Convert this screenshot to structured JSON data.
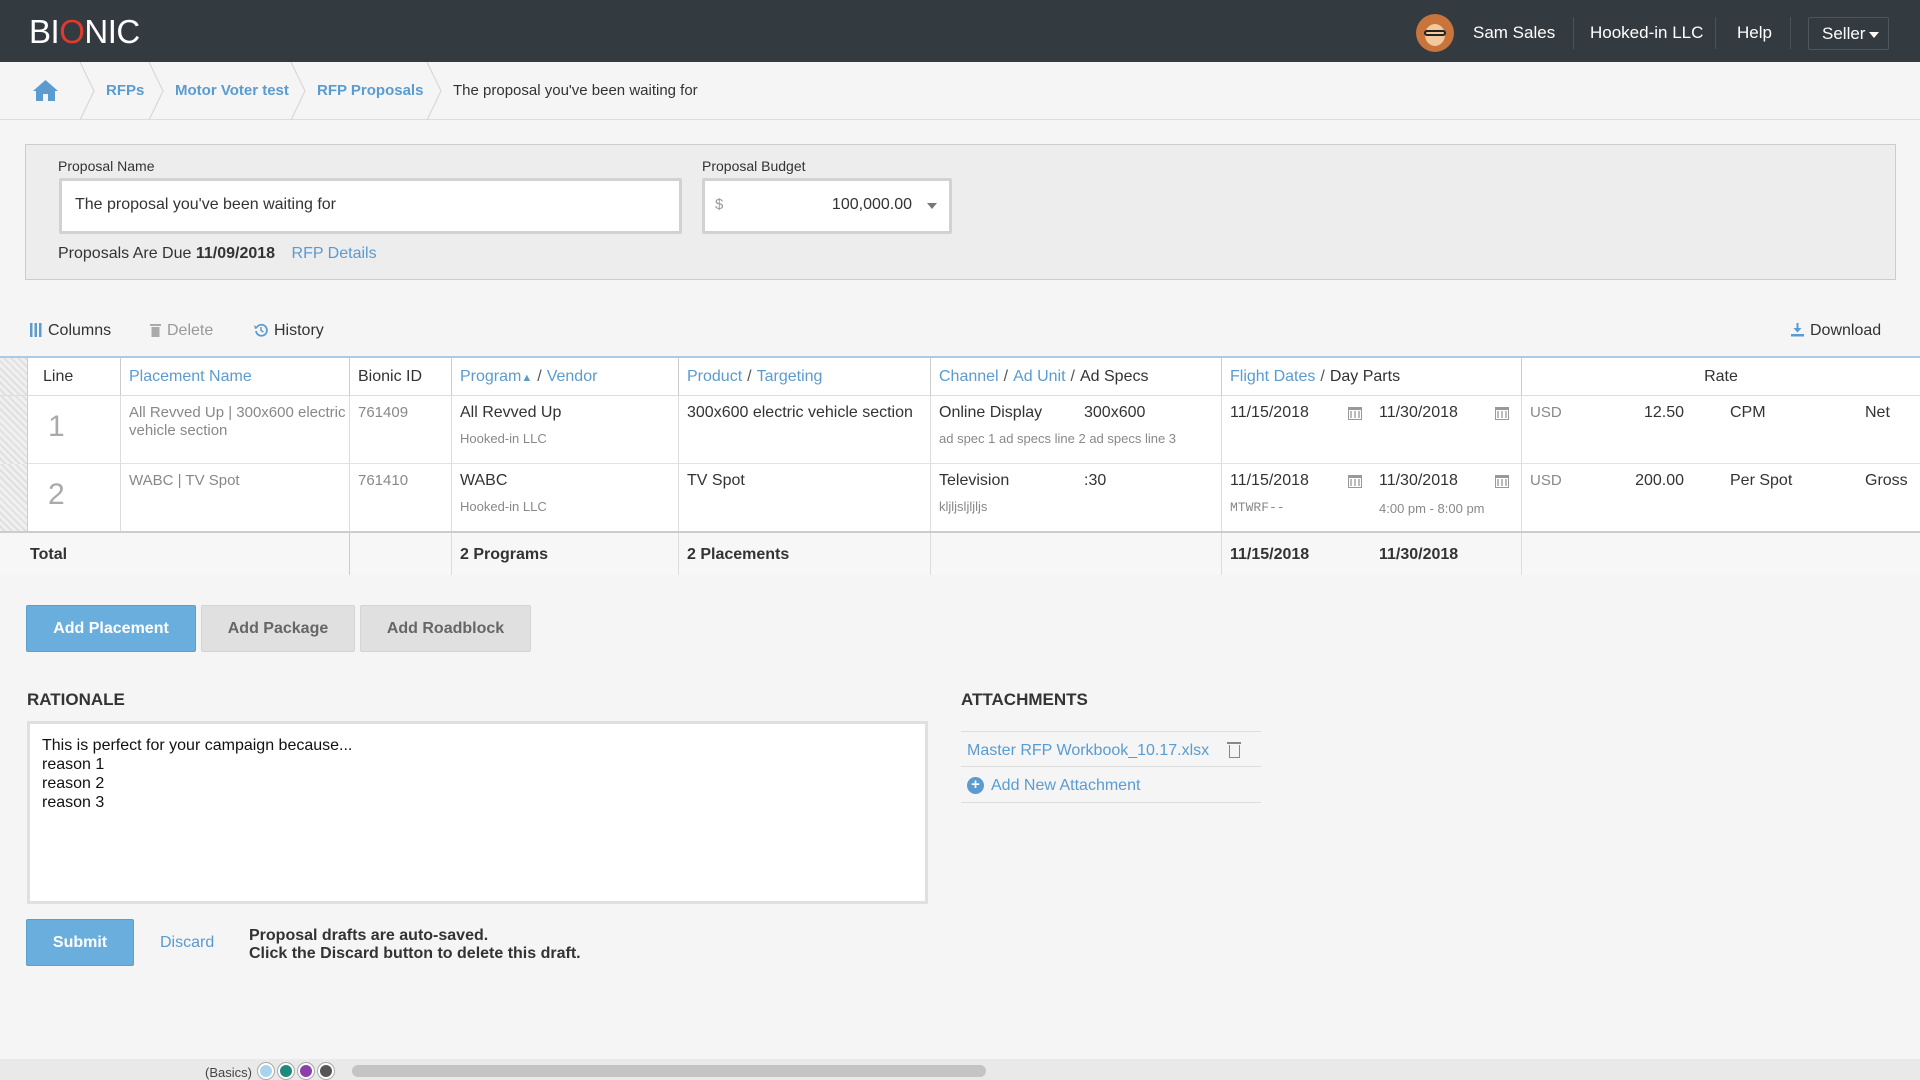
{
  "app": {
    "logo_prefix": "BI",
    "logo_o": "O",
    "logo_suffix": "NIC"
  },
  "topbar": {
    "user_name": "Sam Sales",
    "company": "Hooked-in LLC",
    "help": "Help",
    "role": "Seller"
  },
  "breadcrumb": {
    "items": [
      "RFPs",
      "Motor Voter test",
      "RFP Proposals"
    ],
    "current": "The proposal you've been waiting for"
  },
  "proposal": {
    "name_label": "Proposal Name",
    "name_value": "The proposal you've been waiting for",
    "budget_label": "Proposal Budget",
    "budget_currency": "$",
    "budget_value": "100,000.00",
    "due_prefix": "Proposals Are Due",
    "due_date": "11/09/2018",
    "rfp_details_link": "RFP Details"
  },
  "toolbar": {
    "columns": "Columns",
    "delete": "Delete",
    "history": "History",
    "download": "Download"
  },
  "table": {
    "headers": {
      "line": "Line",
      "placement_name": "Placement Name",
      "bionic_id": "Bionic ID",
      "program": "Program",
      "vendor": "Vendor",
      "product": "Product",
      "targeting": "Targeting",
      "channel": "Channel",
      "ad_unit": "Ad Unit",
      "ad_specs": "Ad Specs",
      "flight_dates": "Flight Dates",
      "day_parts": "Day Parts",
      "rate": "Rate",
      "separator": "/"
    },
    "rows": [
      {
        "line": "1",
        "placement_name": "All Revved Up | 300x600 electric vehicle section",
        "bionic_id": "761409",
        "program": "All Revved Up",
        "vendor": "Hooked-in LLC",
        "product": "300x600 electric vehicle section",
        "channel": "Online Display",
        "ad_unit": "300x600",
        "ad_specs": "ad spec 1 ad specs line 2 ad specs line 3",
        "start_date": "11/15/2018",
        "end_date": "11/30/2018",
        "day_days": "",
        "day_times": "",
        "currency": "USD",
        "rate": "12.50",
        "rate_type": "CPM",
        "net_gross": "Net"
      },
      {
        "line": "2",
        "placement_name": "WABC | TV Spot",
        "bionic_id": "761410",
        "program": "WABC",
        "vendor": "Hooked-in LLC",
        "product": "TV Spot",
        "channel": "Television",
        "ad_unit": ":30",
        "ad_specs": "kljljsljljljs",
        "start_date": "11/15/2018",
        "end_date": "11/30/2018",
        "day_days": "MTWRF--",
        "day_times": "4:00 pm - 8:00 pm",
        "currency": "USD",
        "rate": "200.00",
        "rate_type": "Per Spot",
        "net_gross": "Gross"
      }
    ],
    "total": {
      "label": "Total",
      "programs": "2 Programs",
      "placements": "2 Placements",
      "start_date": "11/15/2018",
      "end_date": "11/30/2018"
    }
  },
  "actions": {
    "add_placement": "Add Placement",
    "add_package": "Add Package",
    "add_roadblock": "Add Roadblock"
  },
  "rationale": {
    "title": "RATIONALE",
    "text": "This is perfect for your campaign because...\nreason 1\nreason 2\nreason 3"
  },
  "attachments": {
    "title": "ATTACHMENTS",
    "file": "Master RFP Workbook_10.17.xlsx",
    "add_new": "Add New Attachment"
  },
  "footer": {
    "submit": "Submit",
    "discard": "Discard",
    "note_line1": "Proposal drafts are auto-saved.",
    "note_line2": "Click the Discard button to delete this draft."
  },
  "bottom_strip": {
    "theme_label": "(Basics)",
    "theme_colors": [
      "#a8d4ee",
      "#1e8a7a",
      "#8b3fa8",
      "#555555"
    ]
  },
  "colors": {
    "accent": "#5a9bd0",
    "topbar": "#333a40",
    "primary_button": "#6aaedd",
    "logo_red": "#e03b2e"
  }
}
